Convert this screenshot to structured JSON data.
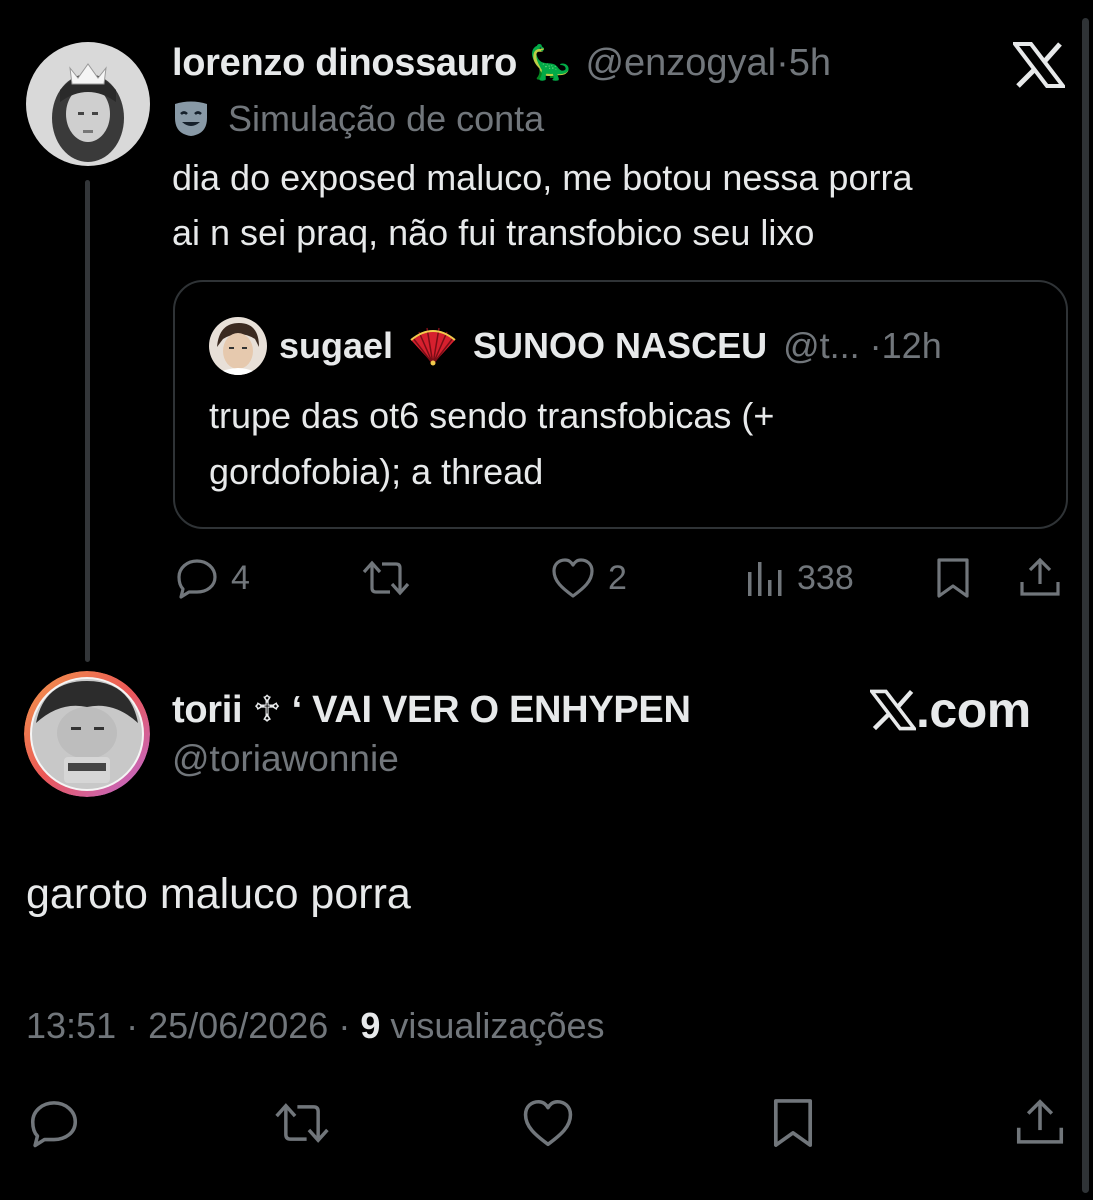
{
  "parent_tweet": {
    "display_name": "lorenzo dinossauro",
    "emoji": "🦕",
    "handle": "@enzogyal",
    "separator": "·",
    "time": "5h",
    "label_icon": "theater-mask-icon",
    "label": "Simulação de conta",
    "text_line1": "dia do exposed maluco, me botou nessa porra",
    "text_line2": "ai n sei praq, não fui transfobico seu lixo",
    "quote": {
      "display_name": "sugael",
      "emoji": "folding-fan-icon",
      "display_name2": "SUNOO NASCEU",
      "handle": "@t...",
      "separator": "·",
      "time": "12h",
      "text_line1": "trupe das ot6 sendo transfobicas (+",
      "text_line2": "gordofobia); a thread"
    },
    "stats": {
      "replies": "4",
      "likes": "2",
      "views": "338"
    }
  },
  "main_tweet": {
    "display_name": "torii ♱ ‘ VAI VER O ENHYPEN",
    "handle": "@toriawonnie",
    "source_badge": ".com",
    "text": "garoto maluco porra",
    "time": "13:51",
    "dot": "·",
    "date": "25/06/2026",
    "views_count": "9",
    "views_label": "visualizações"
  },
  "colors": {
    "background": "#000000",
    "text": "#e7e9ea",
    "secondary": "#71767b",
    "border": "#2f3336"
  }
}
